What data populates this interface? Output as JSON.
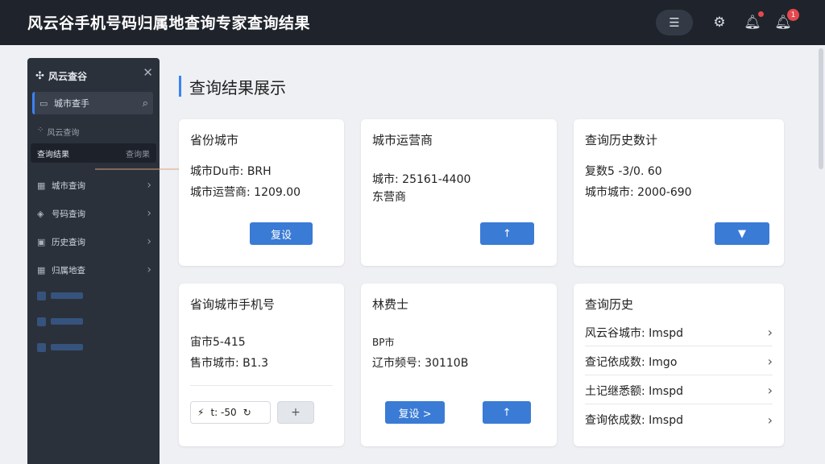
{
  "app": {
    "title": "风云谷手机号码归属地查询专家查询结果"
  },
  "topbar": {
    "menu_icon": "menu-icon",
    "settings_icon": "gear-icon",
    "notify_icon": "bell-icon",
    "alert_icon": "bell-icon",
    "badge_count": "1"
  },
  "sidebar": {
    "title": "风云查谷",
    "search_label": "城市查手",
    "sub_label": "风云查询",
    "active_item": {
      "label": "查询结果",
      "right": "查询果"
    },
    "items": [
      {
        "label": "城市查询",
        "icon": "grid-icon"
      },
      {
        "label": "号码查询",
        "icon": "shield-icon"
      },
      {
        "label": "历史查询",
        "icon": "folder-icon"
      },
      {
        "label": "归属地查",
        "icon": "grid-icon"
      }
    ]
  },
  "page": {
    "title": "查询结果展示"
  },
  "cards": {
    "province": {
      "title": "省份城市",
      "line1": "城市Du市: BRH",
      "line2": "城市运营商: 1209.00",
      "button": "复设"
    },
    "carrier": {
      "title": "城市运营商",
      "line1": "城市: 25161-4400",
      "line2": "东营商",
      "button_icon": "arrow-up-icon",
      "button": "↑"
    },
    "history_stats": {
      "title": "查询历史数计",
      "line1": "复数5 -3/0. 60",
      "line2": "城市城市: 2000-690",
      "button": "▼"
    },
    "phone": {
      "title": "省询城市手机号",
      "line1": "宙市5-415",
      "line2": "售市城市: B1.3",
      "chip_value": "t: -50",
      "chip_btn": "+"
    },
    "misc": {
      "title": "林费士",
      "line1": "BP市",
      "line2": "辽市频号: 30110B",
      "button_left": "复设 >",
      "button_right": "↑"
    },
    "history": {
      "title": "查询历史",
      "rows": [
        {
          "label": "风云谷城市: Imspd"
        },
        {
          "label": "查记依成数: Imgo"
        },
        {
          "label": "土记继悉额: Imspd"
        },
        {
          "label": "查询依成数: Imspd"
        }
      ]
    }
  },
  "colors": {
    "accent": "#3a7bd5",
    "topbar": "#1f232b",
    "sidebar": "#2b313b",
    "badge": "#e5484d"
  }
}
